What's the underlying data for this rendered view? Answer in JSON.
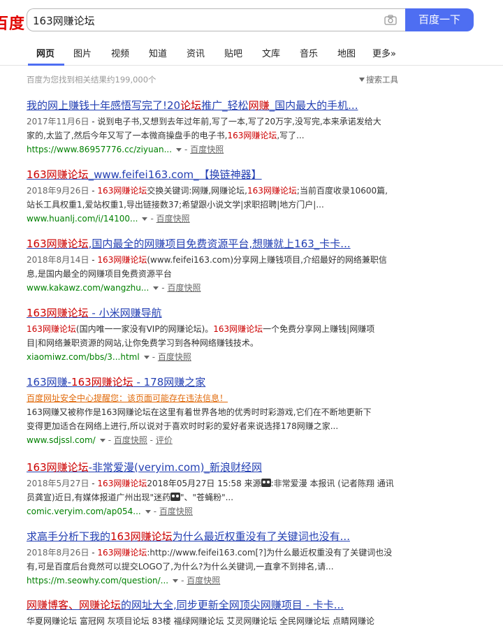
{
  "header": {
    "logo": "百度",
    "query": "163网赚论坛",
    "search_button": "百度一下"
  },
  "tabs": [
    "网页",
    "图片",
    "视频",
    "知道",
    "资讯",
    "贴吧",
    "文库",
    "音乐",
    "地图",
    "更多»"
  ],
  "result_count": "百度为您找到相关结果约199,000个",
  "tools_label": "搜索工具",
  "results": [
    {
      "title": [
        "我的网上赚钱十年感悟写完了!20",
        "论坛",
        "推广_轻松",
        "网赚",
        "_国内最大的手机..."
      ],
      "date": "2017年11月6日",
      "abstract_1": " - 说到电子书,又想到去年过年前,写了一本,写了20万字,没写完,本来承诺发给大",
      "abstract_2a": "家的,太监了,然后今年又写了一本微商操盘手的电子书,",
      "abstract_2hl": "163网赚论坛",
      "abstract_2b": ",写了...",
      "url": "https://www.86957776.cc/ziyuan...",
      "cache": "百度快照"
    },
    {
      "title": [
        "163网赚论坛",
        "_www.feifei163.com_【换链神器】"
      ],
      "date": "2018年9月26日",
      "abstract_1a": " - ",
      "abstract_1hl1": "163网赚论坛",
      "abstract_1b": "交换关键词:网赚,网赚论坛,",
      "abstract_1hl2": "163网赚论坛",
      "abstract_1c": ";当前百度收录10600篇,",
      "abstract_2": "站长工具权重1,爱站权重1,导出链接数37;希望跟小说文学|求职招聘|地方门户|...",
      "url": "www.huanlj.com/i/14100...",
      "cache": "百度快照"
    },
    {
      "title": [
        "163网赚论坛",
        ",国内最全的网赚项目免费资源平台,想赚就上163_卡卡..."
      ],
      "date": "2018年8月14日",
      "abstract_1a": " - ",
      "abstract_1hl": "163网赚论坛",
      "abstract_1b": "(www.feifei163.com)分享网上赚钱项目,介绍最好的网络兼职信",
      "abstract_2": "息,是国内最全的网赚项目免费资源平台",
      "url": "www.kakawz.com/wangzhu...",
      "cache": "百度快照"
    },
    {
      "title": [
        "163网赚论坛",
        " - 小米网赚导航"
      ],
      "abstract_1hl1": "163网赚论坛",
      "abstract_1a": "(国内唯一一家没有VIP的网赚论坛)。",
      "abstract_1hl2": "163网赚论坛",
      "abstract_1b": "一个免费分享网上赚钱|网赚项",
      "abstract_2": "目|和网络兼职资源的网站,让你免费学习到各种网络赚钱技术。",
      "url": "xiaomiwz.com/bbs/3...html",
      "cache": "百度快照"
    },
    {
      "title": [
        "163网赚-",
        "163网赚论坛",
        " - 178网赚之家"
      ],
      "warning": "百度网址安全中心提醒您：该页面可能存在违法信息！",
      "abstract_1": "163网赚又被称作是163网赚论坛在这里有着世界各地的优秀时时彩游戏,它们在不断地更新下",
      "abstract_2": "变得更加适合在网络上进行,所以说对于喜欢时时彩的爱好者来说选择178网赚之家...",
      "url": "www.sdjssl.com/",
      "cache": "百度快照",
      "review": "评价"
    },
    {
      "title": [
        "163网赚论坛",
        "-非常爱漫(veryim.com)_新浪财经网"
      ],
      "date": "2018年5月27日",
      "abstract_1a": " - ",
      "abstract_1hl": "163网赚论坛",
      "abstract_1b": "2018年05月27日 15:58 来源",
      "abstract_1c": ":非常爱漫 本报讯 (记者陈翔 通讯",
      "abstract_2a": "员龚宣)近日,有媒体报道广州出现\"迷药",
      "abstract_2b": "\"、\"苍蝇粉\"...",
      "url": "comic.veryim.com/ap054...",
      "cache": "百度快照"
    },
    {
      "title": [
        "求高手分析下我的",
        "163网赚论坛",
        "为什么最近权重没有了关键词也没有..."
      ],
      "date": "2018年8月26日",
      "abstract_1a": " - ",
      "abstract_1hl": "163网赚论坛",
      "abstract_1b": ":http://www.feifei163.com[?]为什么最近权重没有了关键词也没",
      "abstract_2": "有,可是百度后台竟然可以提交LOGO了,为什么?为什么关键词,一直拿不到排名,请...",
      "url": "https://m.seowhy.com/question/...",
      "cache": "百度快照"
    },
    {
      "title": [
        "网赚博客、",
        "网赚论坛",
        "的网址大全,同步更新全网顶尖网赚项目 - 卡卡..."
      ],
      "abstract_1": "华夏网赚论坛 富冠网 灰项目论坛 83楼 福绿网赚论坛 艾灵网赚论坛 全民网赚论坛 点睛网赚论"
    }
  ]
}
